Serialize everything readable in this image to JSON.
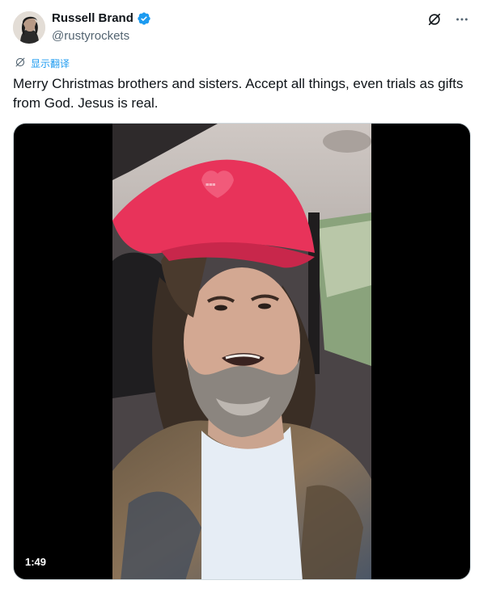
{
  "author": {
    "display_name": "Russell Brand",
    "handle": "@rustyrockets",
    "verified": true
  },
  "actions": {
    "grok_icon": "grok-icon",
    "more_icon": "more-options-icon"
  },
  "translate": {
    "label": "显示翻译"
  },
  "tweet": {
    "text": "Merry Christmas brothers and sisters. Accept all things, even trials as gifts from God. Jesus is real."
  },
  "media": {
    "type": "video",
    "duration": "1:49"
  },
  "colors": {
    "accent": "#1d9bf0",
    "secondary_text": "#536471",
    "primary_text": "#0f1419",
    "cap": "#e8335a"
  }
}
